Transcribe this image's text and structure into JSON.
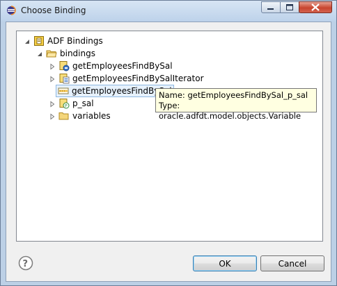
{
  "window": {
    "title": "Choose Binding"
  },
  "tree": {
    "root": "ADF Bindings",
    "folder": "bindings",
    "items": [
      "getEmployeesFindBySal",
      "getEmployeesFindBySalIterator",
      "getEmployeesFindBySal",
      "p_sal",
      "variables"
    ]
  },
  "tooltip": {
    "name_line": "Name: getEmployeesFindBySal_p_sal",
    "type_line": "Type: oracle.adfdt.model.objects.Variable"
  },
  "buttons": {
    "ok": "OK",
    "cancel": "Cancel"
  },
  "colors": {
    "titlebar": "#bcd0e6",
    "close": "#c8452f",
    "tooltip_bg": "#ffffe1",
    "selection": "#e6f1fc"
  },
  "icons": [
    "eclipse-app-icon",
    "help-icon",
    "expand-arrow-icon",
    "folder-icon",
    "binding-icon",
    "iterator-icon",
    "variable-icon"
  ]
}
